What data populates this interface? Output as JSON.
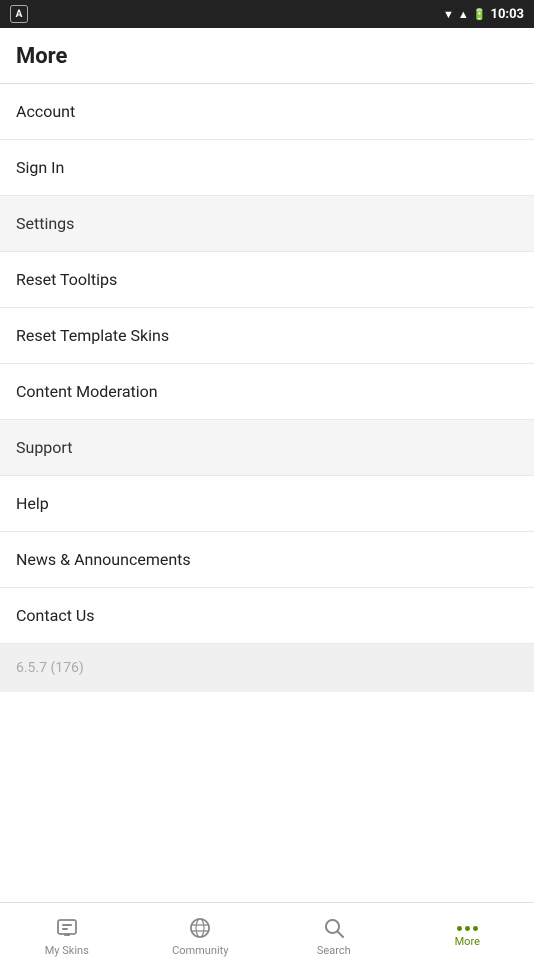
{
  "statusBar": {
    "time": "10:03"
  },
  "page": {
    "title": "More"
  },
  "menuItems": [
    {
      "id": "account",
      "label": "Account",
      "style": "normal"
    },
    {
      "id": "sign-in",
      "label": "Sign In",
      "style": "normal"
    },
    {
      "id": "settings",
      "label": "Settings",
      "style": "shaded"
    },
    {
      "id": "reset-tooltips",
      "label": "Reset Tooltips",
      "style": "normal"
    },
    {
      "id": "reset-template-skins",
      "label": "Reset Template Skins",
      "style": "normal"
    },
    {
      "id": "content-moderation",
      "label": "Content Moderation",
      "style": "normal"
    },
    {
      "id": "support",
      "label": "Support",
      "style": "shaded"
    },
    {
      "id": "help",
      "label": "Help",
      "style": "normal"
    },
    {
      "id": "news-announcements",
      "label": "News & Announcements",
      "style": "normal"
    },
    {
      "id": "contact-us",
      "label": "Contact Us",
      "style": "normal"
    }
  ],
  "version": "6.5.7 (176)",
  "bottomNav": {
    "items": [
      {
        "id": "my-skins",
        "label": "My Skins",
        "icon": "skins",
        "active": false
      },
      {
        "id": "community",
        "label": "Community",
        "icon": "community",
        "active": false
      },
      {
        "id": "search",
        "label": "Search",
        "icon": "search",
        "active": false
      },
      {
        "id": "more",
        "label": "More",
        "icon": "more",
        "active": true
      }
    ]
  }
}
